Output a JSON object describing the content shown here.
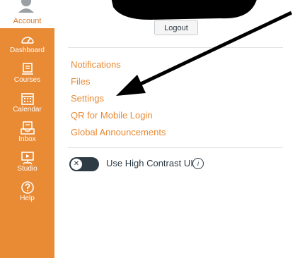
{
  "account": {
    "label": "Account"
  },
  "nav": {
    "items": [
      {
        "label": "Dashboard",
        "icon": "dashboard-icon"
      },
      {
        "label": "Courses",
        "icon": "courses-icon"
      },
      {
        "label": "Calendar",
        "icon": "calendar-icon"
      },
      {
        "label": "Inbox",
        "icon": "inbox-icon"
      },
      {
        "label": "Studio",
        "icon": "studio-icon"
      },
      {
        "label": "Help",
        "icon": "help-icon"
      }
    ]
  },
  "tray": {
    "logout_label": "Logout",
    "links": [
      {
        "label": "Notifications"
      },
      {
        "label": "Files"
      },
      {
        "label": "Settings"
      },
      {
        "label": "QR for Mobile Login"
      },
      {
        "label": "Global Announcements"
      }
    ],
    "contrast_toggle_label": "Use High Contrast UI",
    "contrast_toggle_knob": "✕",
    "info_glyph": "i"
  },
  "colors": {
    "rail": "#e98a35",
    "link": "#e98a35",
    "text": "#2d3b45"
  }
}
